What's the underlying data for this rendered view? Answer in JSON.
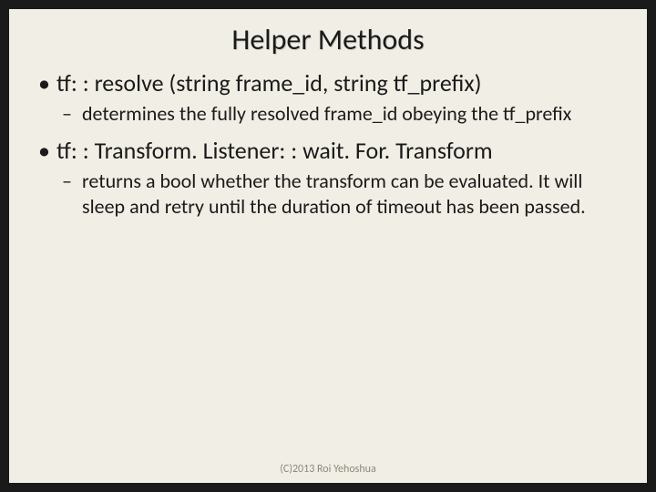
{
  "title": "Helper Methods",
  "bullets": [
    {
      "text": "tf: : resolve (string frame_id, string tf_prefix)",
      "sub": [
        "determines the fully resolved frame_id obeying the tf_prefix"
      ]
    },
    {
      "text": "tf: : Transform. Listener: : wait. For. Transform",
      "sub": [
        "returns a bool whether the transform can be evaluated. It will sleep and retry until the duration of timeout has been passed."
      ]
    }
  ],
  "footer": "(C)2013 Roi Yehoshua"
}
